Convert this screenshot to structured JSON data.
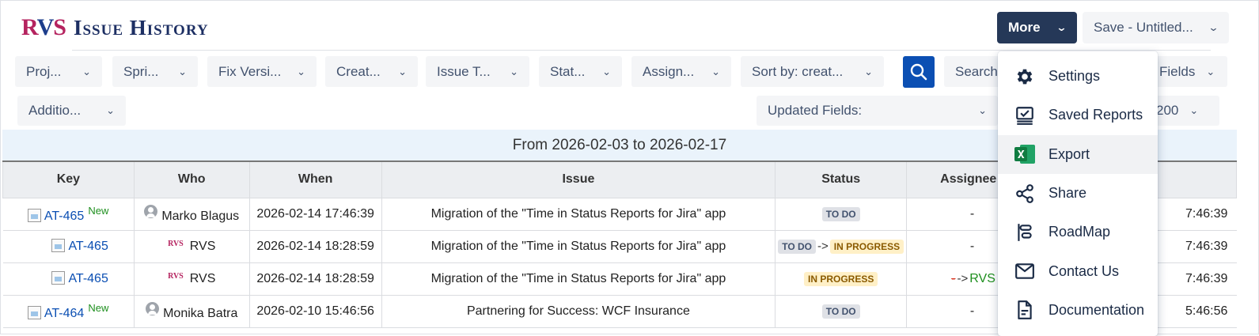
{
  "app": {
    "logo": "RVS",
    "title": "Issue History"
  },
  "header": {
    "more_label": "More",
    "save_label": "Save - Untitled..."
  },
  "filters": [
    {
      "label": "Proj..."
    },
    {
      "label": "Spri..."
    },
    {
      "label": "Fix Versi..."
    },
    {
      "label": "Creat..."
    },
    {
      "label": "Issue T..."
    },
    {
      "label": "Stat..."
    },
    {
      "label": "Assign..."
    },
    {
      "label": "Sort by: creat..."
    }
  ],
  "search": {
    "placeholder": "Search"
  },
  "fields_label": "Fields",
  "additional_label": "Additio...",
  "updated_fields_label": "Updated Fields:",
  "page_size": "200",
  "range_text": "From 2026-02-03 to 2026-02-17",
  "table": {
    "columns": [
      "Key",
      "Who",
      "When",
      "Issue",
      "Status",
      "Assignee",
      ""
    ],
    "rows": [
      {
        "key": "AT-465",
        "new": "New",
        "who": "Marko Blagus",
        "who_type": "user",
        "when": "2026-02-14 17:46:39",
        "issue": "Migration of the \"Time in Status Reports for Jira\" app",
        "status_from": "",
        "status_to": "TO DO",
        "assignee": "-",
        "last": "7:46:39"
      },
      {
        "key": "AT-465",
        "new": "",
        "who": "RVS",
        "who_type": "app",
        "when": "2026-02-14 18:28:59",
        "issue": "Migration of the \"Time in Status Reports for Jira\" app",
        "status_from": "TO DO",
        "status_to": "IN PROGRESS",
        "assignee": "-",
        "last": "7:46:39"
      },
      {
        "key": "AT-465",
        "new": "",
        "who": "RVS",
        "who_type": "app",
        "when": "2026-02-14 18:28:59",
        "issue": "Migration of the \"Time in Status Reports for Jira\" app",
        "status_from": "",
        "status_to": "IN PROGRESS",
        "assignee_from": "-",
        "assignee_to": "RVS",
        "last": "7:46:39"
      },
      {
        "key": "AT-464",
        "new": "New",
        "who": "Monika Batra",
        "who_type": "user",
        "when": "2026-02-10 15:46:56",
        "issue": "Partnering for Success: WCF Insurance",
        "status_from": "",
        "status_to": "TO DO",
        "assignee": "-",
        "last": "5:46:56"
      }
    ]
  },
  "menu": {
    "items": [
      {
        "label": "Settings",
        "icon": "gear-icon"
      },
      {
        "label": "Saved Reports",
        "icon": "saved-reports-icon"
      },
      {
        "label": "Export",
        "icon": "excel-icon"
      },
      {
        "label": "Share",
        "icon": "share-icon"
      },
      {
        "label": "RoadMap",
        "icon": "roadmap-icon"
      },
      {
        "label": "Contact Us",
        "icon": "mail-icon"
      },
      {
        "label": "Documentation",
        "icon": "document-icon"
      }
    ]
  },
  "colors": {
    "primary_button": "#253858",
    "search_button": "#0b4fb3",
    "brand_magenta": "#b5235f",
    "brand_navy": "#1d3d8b",
    "excel_green": "#1d7a45"
  }
}
